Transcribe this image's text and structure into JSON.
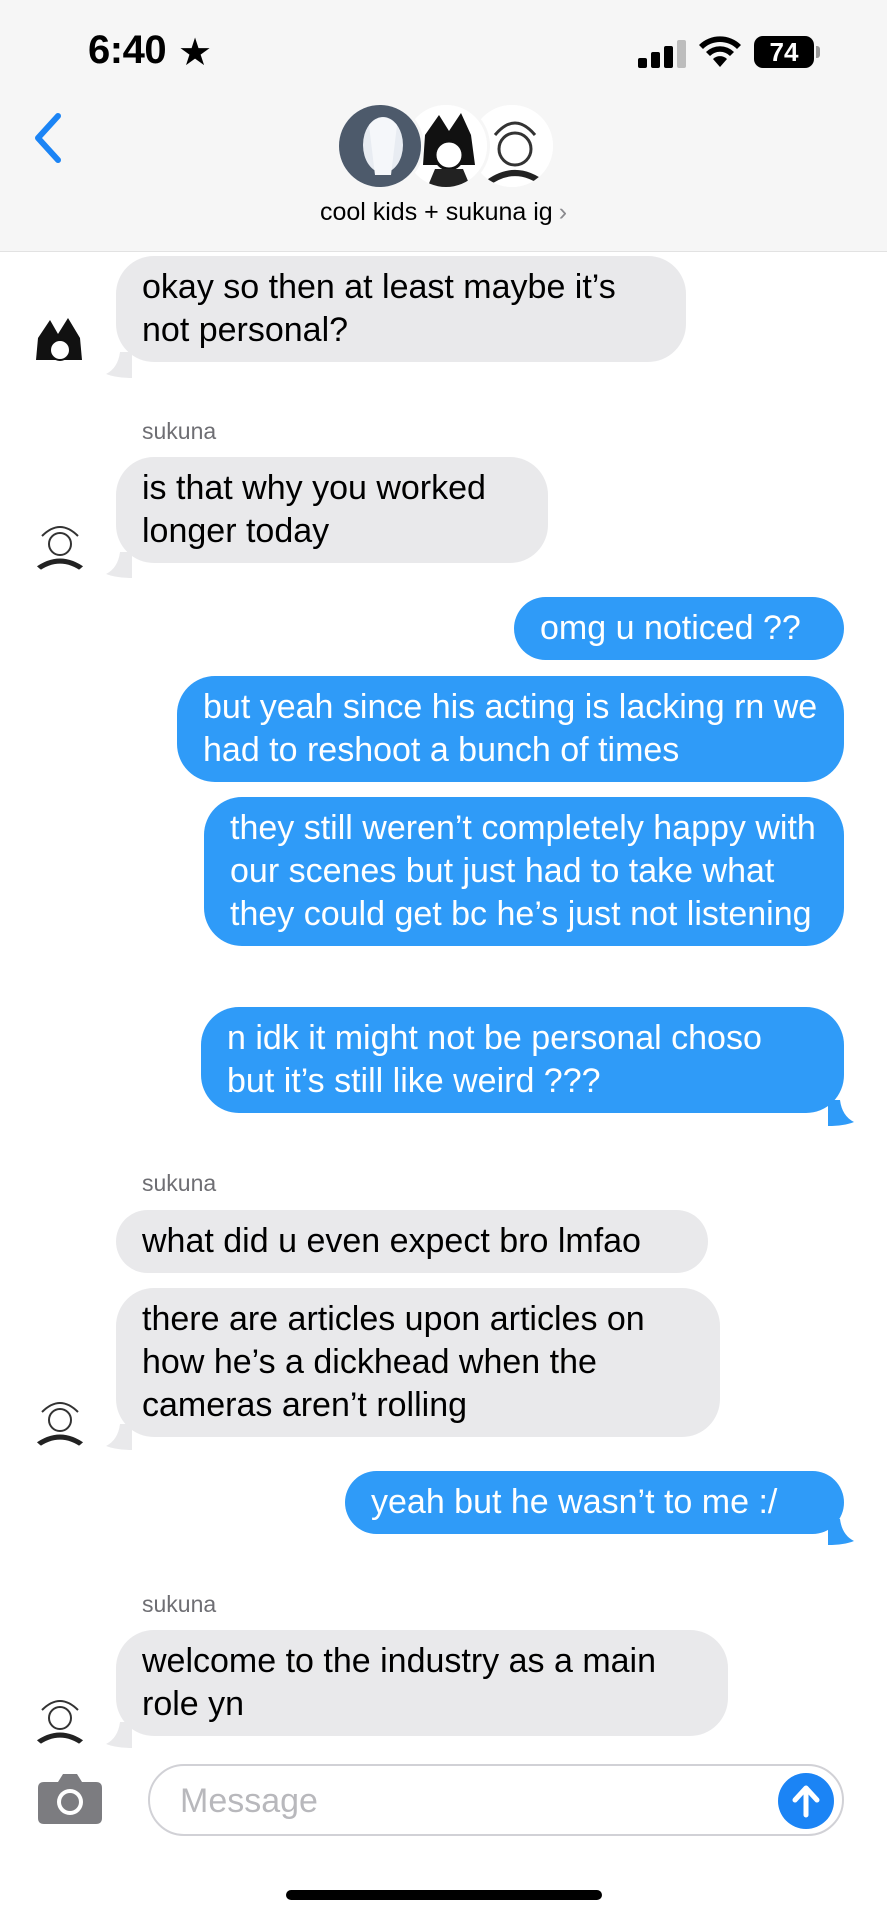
{
  "status_bar": {
    "time": "6:40",
    "battery": "74"
  },
  "header": {
    "title": "cool kids + sukuna ig",
    "chevron": "›"
  },
  "messages": {
    "m1": "okay so then at least maybe it’s not personal?",
    "s1": "sukuna",
    "m2": "is that why you worked longer today",
    "m3": "omg u noticed ??",
    "m4": "but yeah since his acting is lacking rn we had to reshoot a bunch of times",
    "m5": "they still weren’t completely happy with our scenes but just had to take what they could get bc he’s just not listening",
    "m6": "n idk it might not be personal choso but it’s still like weird ???",
    "s2": "sukuna",
    "m7": "what did u even expect bro lmfao",
    "m8": "there are articles upon articles on how he’s a dickhead when the cameras aren’t rolling",
    "m9": "yeah but he wasn’t to me :/",
    "s3": "sukuna",
    "m10": "welcome to the industry as a main role yn"
  },
  "composer": {
    "placeholder": "Message"
  },
  "colors": {
    "incoming": "#e9e9eb",
    "outgoing": "#2f9bf8",
    "accent": "#1b84f5"
  }
}
